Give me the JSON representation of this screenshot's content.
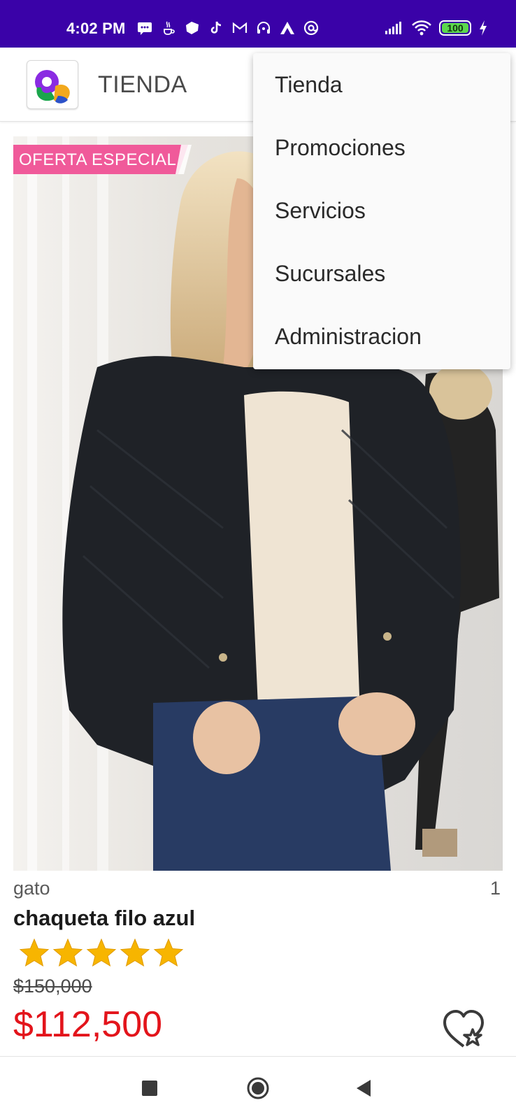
{
  "status_bar": {
    "time": "4:02 PM",
    "battery_level": "100",
    "icons_left": [
      "message-icon",
      "java-icon",
      "cloud-app-icon",
      "tiktok-icon",
      "gmail-icon",
      "headset-icon",
      "arc-icon",
      "at-sign-icon"
    ],
    "icons_right": [
      "signal-icon",
      "wifi-icon",
      "battery-icon",
      "charging-icon"
    ]
  },
  "app_bar": {
    "title": "TIENDA",
    "logo": "app-logo"
  },
  "menu": {
    "items": [
      {
        "label": "Tienda"
      },
      {
        "label": "Promociones"
      },
      {
        "label": "Servicios"
      },
      {
        "label": "Sucursales"
      },
      {
        "label": "Administracion"
      }
    ]
  },
  "product": {
    "badge": "OFERTA ESPECIAL",
    "category": "gato",
    "quantity": "1",
    "name": "chaqueta filo azul",
    "rating": 5,
    "rating_max": 5,
    "price_old": "$150,000",
    "price_new": "$112,500"
  },
  "colors": {
    "status_bar": "#3a02a8",
    "price_red": "#e3141b",
    "badge_pink": "#f05a9a",
    "star_gold": "#f7b500"
  },
  "nav_bar": {
    "buttons": [
      "recents-square-icon",
      "home-circle-icon",
      "back-triangle-icon"
    ]
  }
}
